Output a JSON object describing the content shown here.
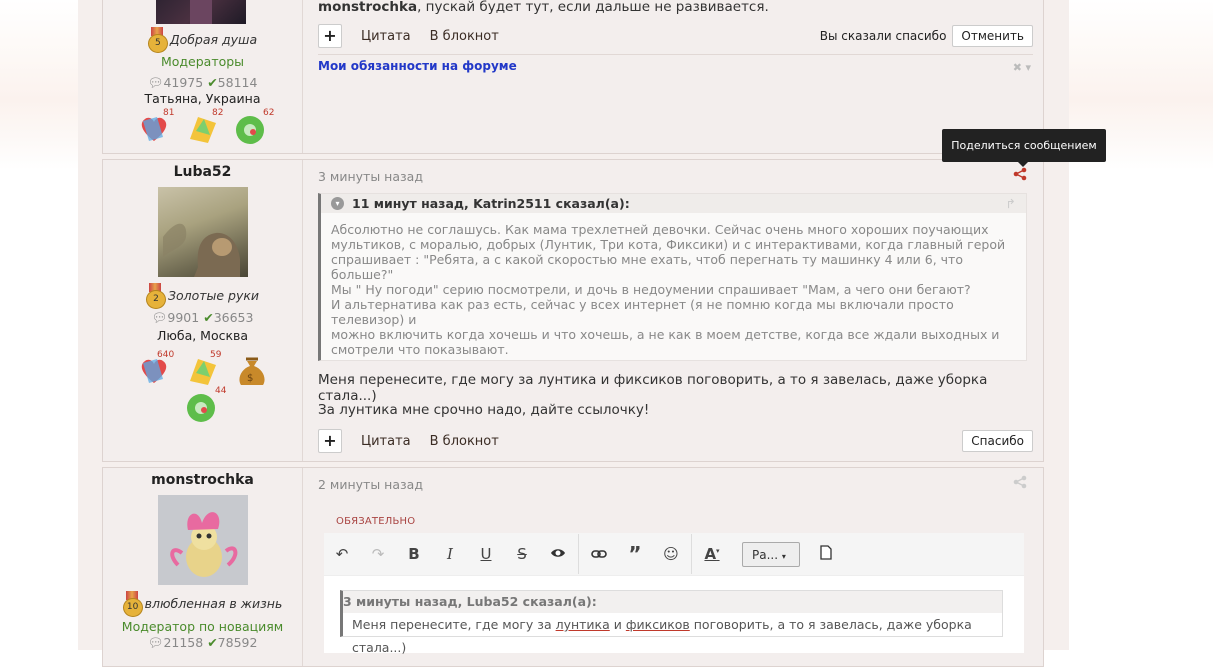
{
  "post1": {
    "rank": "Добрая душа",
    "rank_level": "5",
    "role": "Модераторы",
    "messages": "41975",
    "likes": "58114",
    "location": "Татьяна, Украина",
    "awards": [
      "81",
      "82",
      "62"
    ],
    "text_author": "monstrochka",
    "text_rest": ", пускай будет тут, если дальше не развивается.",
    "plus": "+",
    "quote_label": "Цитата",
    "notebook_label": "В блокнот",
    "you_thanked": "Вы сказали спасибо",
    "cancel_label": "Отменить",
    "signature": "Мои обязанности на форуме",
    "close_glyph": "✖ ▾"
  },
  "tooltip": "Поделиться сообщением",
  "post2": {
    "username": "Luba52",
    "rank": "Золотые руки",
    "rank_level": "2",
    "messages": "9901",
    "likes": "36653",
    "location": "Люба, Москва",
    "awards": [
      "640",
      "59",
      "",
      "44"
    ],
    "time": "3 минуты назад",
    "quote_head": "11 минут назад, Katrin2511 сказал(а):",
    "quote_lines": [
      "Абсолютно не соглашусь. Как мама трехлетней девочки. Сейчас очень много хороших поучающих",
      "мультиков, с моралью, добрых (Лунтик, Три кота, Фиксики) и с интерактивами, когда главный герой",
      "спрашивает : \"Ребята, а с какой скоростью мне ехать, чтоб перегнать ту машинку 4 или 6, что больше?\"",
      "Мы \" Ну погоди\" серию посмотрели, и дочь в недоумении спрашивает \"Мам, а чего они бегают?",
      "И альтернатива как раз есть, сейчас у всех интернет (я не помню когда мы включали просто телевизор) и",
      "можно включить когда хочешь и что хочешь, а не как в моем детстве, когда все ждали выходных и",
      "смотрели что показывают."
    ],
    "text1": "Меня перенесите, где могу за лунтика и фиксиков поговорить, а то я завелась, даже уборка стала...)",
    "text2": "За лунтика мне срочно надо, дайте ссылочку!",
    "plus": "+",
    "quote_label": "Цитата",
    "notebook_label": "В блокнот",
    "thanks_label": "Спасибо"
  },
  "post3": {
    "username": "monstrochka",
    "rank": "влюбленная в жизнь",
    "rank_level": "10",
    "role": "Модератор по новациям",
    "messages": "21158",
    "likes": "78592",
    "time": "2 минуты назад",
    "required": "ОБЯЗАТЕЛЬНО",
    "font_dropdown": "Ра...",
    "editor_quote_head": "3 минуты назад, Luba52 сказал(а):",
    "editor_quote": {
      "p1": "Меня перенесите, где могу за ",
      "w1": "лунтика",
      "p2": " и ",
      "w2": "фиксиков",
      "p3": " поговорить, а то я завелась, даже уборка стала...)"
    }
  }
}
